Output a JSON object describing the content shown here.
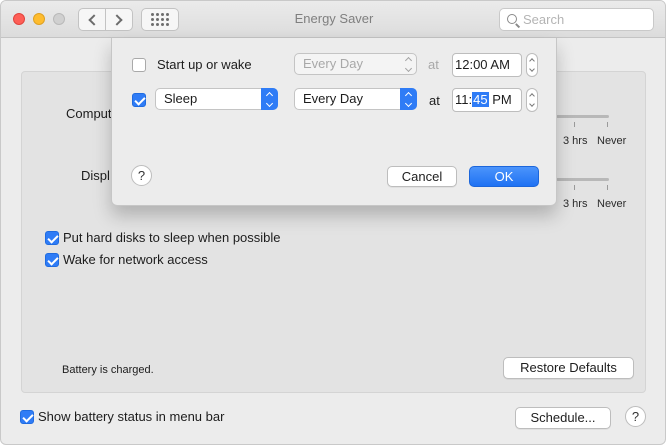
{
  "window": {
    "title": "Energy Saver"
  },
  "search": {
    "placeholder": "Search"
  },
  "panel": {
    "computer_label_fragment": "Comput",
    "display_label_fragment": "Displ",
    "computer_ticks": [
      "3 hrs",
      "Never"
    ],
    "display_ticks": [
      "3 hrs",
      "Never"
    ],
    "options": [
      {
        "label": "Put hard disks to sleep when possible",
        "checked": true
      },
      {
        "label": "Wake for network access",
        "checked": true
      }
    ],
    "battery_status": "Battery is charged.",
    "restore_defaults": "Restore Defaults"
  },
  "footer": {
    "show_battery_label": "Show battery status in menu bar",
    "show_battery_checked": true,
    "schedule_button": "Schedule...",
    "help": "?"
  },
  "sheet": {
    "row1": {
      "checked": false,
      "label": "Start up or wake",
      "day": "Every Day",
      "at": "at",
      "time": "12:00 AM"
    },
    "row2": {
      "checked": true,
      "action": "Sleep",
      "day": "Every Day",
      "at": "at",
      "time_hour": "11:",
      "time_minute": "45",
      "time_ampm": " PM"
    },
    "help": "?",
    "cancel": "Cancel",
    "ok": "OK"
  },
  "colors": {
    "accent": "#2f7cf6",
    "window_bg": "#ececec"
  }
}
